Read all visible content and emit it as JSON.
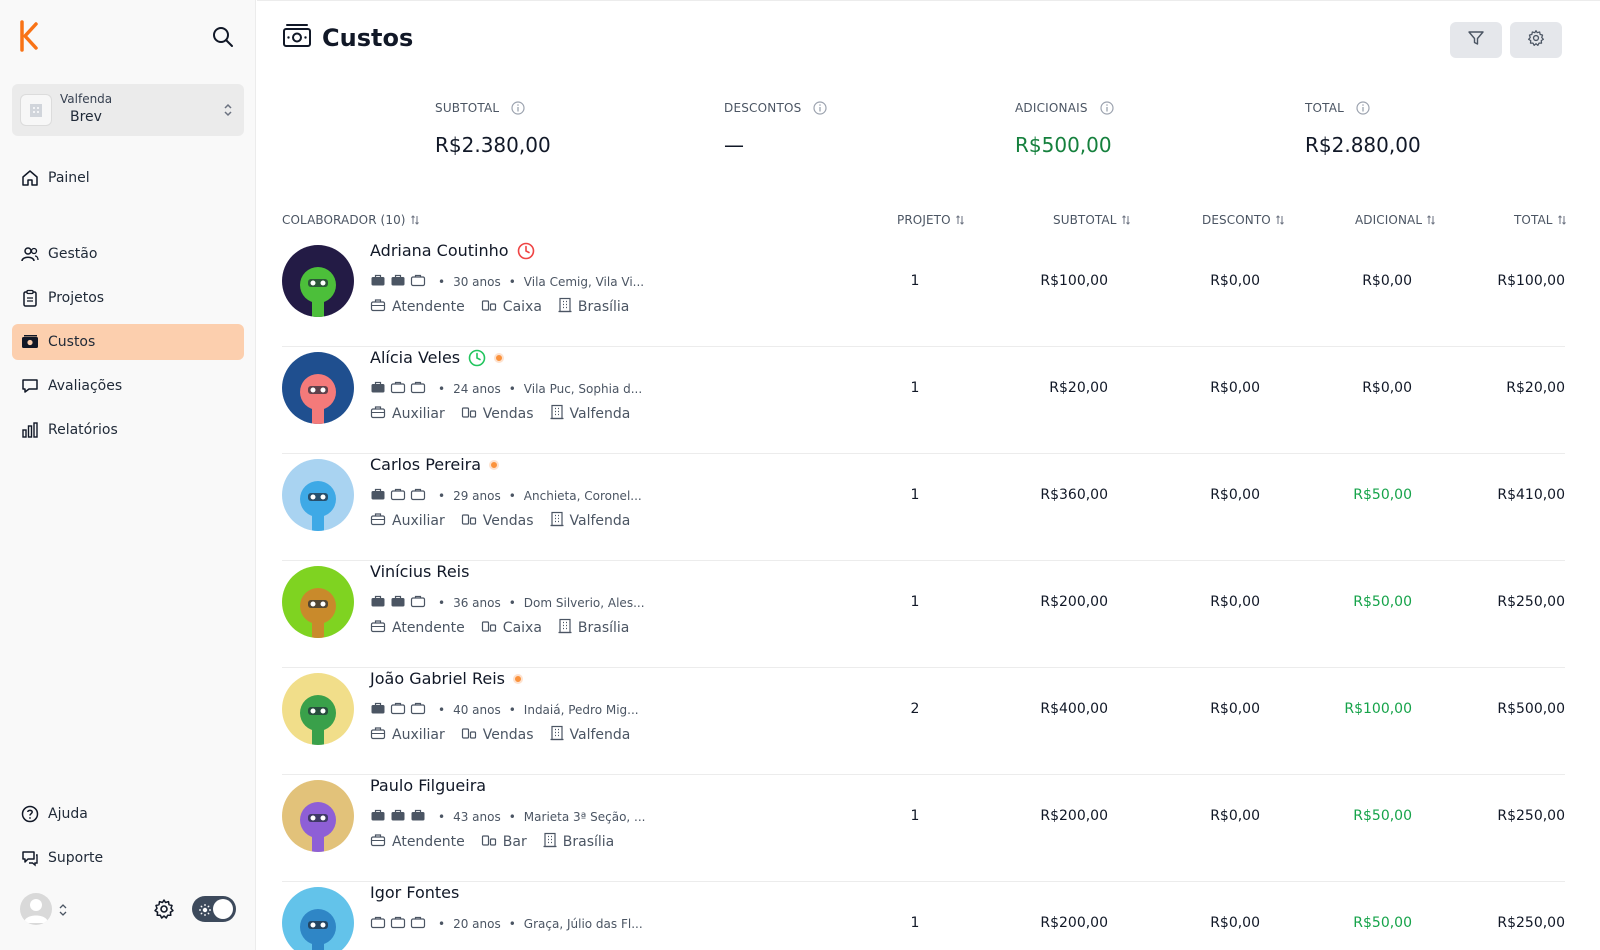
{
  "sidebar": {
    "org": {
      "sub": "Valfenda",
      "name": "Brev"
    },
    "nav": [
      {
        "label": "Painel",
        "icon": "home-icon"
      },
      {
        "label": "Gestão",
        "icon": "users-icon"
      },
      {
        "label": "Projetos",
        "icon": "clipboard-icon"
      },
      {
        "label": "Custos",
        "icon": "money-icon",
        "active": true
      },
      {
        "label": "Avaliações",
        "icon": "chat-icon"
      },
      {
        "label": "Relatórios",
        "icon": "bar-chart-icon"
      }
    ],
    "bottom": [
      {
        "label": "Ajuda",
        "icon": "help-icon"
      },
      {
        "label": "Suporte",
        "icon": "support-icon"
      }
    ]
  },
  "header": {
    "title": "Custos"
  },
  "summary": {
    "subtotal_label": "SUBTOTAL",
    "subtotal_value": "R$2.380,00",
    "discount_label": "DESCONTOS",
    "discount_value": "—",
    "extra_label": "ADICIONAIS",
    "extra_value": "R$500,00",
    "total_label": "TOTAL",
    "total_value": "R$2.880,00"
  },
  "table": {
    "headers": {
      "collaborator": "COLABORADOR (10)",
      "project": "PROJETO",
      "subtotal": "SUBTOTAL",
      "discount": "DESCONTO",
      "extra": "ADICIONAL",
      "total": "TOTAL"
    },
    "rows": [
      {
        "name": "Adriana Coutinho",
        "status": "clock-red",
        "level": 2,
        "age": "30 anos",
        "address": "Vila Cemig, Vila Vi...",
        "role": "Atendente",
        "sector": "Caixa",
        "unit": "Brasília",
        "project": "1",
        "subtotal": "R$100,00",
        "discount": "R$0,00",
        "extra": "R$0,00",
        "extra_green": false,
        "total": "R$100,00",
        "bg": "#231b45",
        "fg": "#4cbf3a"
      },
      {
        "name": "Alícia Veles",
        "status": "clock-green-dot",
        "level": 1,
        "age": "24 anos",
        "address": "Vila Puc, Sophia d...",
        "role": "Auxiliar",
        "sector": "Vendas",
        "unit": "Valfenda",
        "project": "1",
        "subtotal": "R$20,00",
        "discount": "R$0,00",
        "extra": "R$0,00",
        "extra_green": false,
        "total": "R$20,00",
        "bg": "#1f4f8f",
        "fg": "#f47a7a"
      },
      {
        "name": "Carlos Pereira",
        "status": "dot",
        "level": 1,
        "age": "29 anos",
        "address": "Anchieta, Coronel...",
        "role": "Auxiliar",
        "sector": "Vendas",
        "unit": "Valfenda",
        "project": "1",
        "subtotal": "R$360,00",
        "discount": "R$0,00",
        "extra": "R$50,00",
        "extra_green": true,
        "total": "R$410,00",
        "bg": "#a9d3f1",
        "fg": "#3ea9e6"
      },
      {
        "name": "Vinícius Reis",
        "status": "",
        "level": 2,
        "age": "36 anos",
        "address": "Dom Silverio, Ales...",
        "role": "Atendente",
        "sector": "Caixa",
        "unit": "Brasília",
        "project": "1",
        "subtotal": "R$200,00",
        "discount": "R$0,00",
        "extra": "R$50,00",
        "extra_green": true,
        "total": "R$250,00",
        "bg": "#7fd321",
        "fg": "#c98a2b"
      },
      {
        "name": "João Gabriel Reis",
        "status": "dot",
        "level": 1,
        "age": "40 anos",
        "address": "Indaiá, Pedro Mig...",
        "role": "Auxiliar",
        "sector": "Vendas",
        "unit": "Valfenda",
        "project": "2",
        "subtotal": "R$400,00",
        "discount": "R$0,00",
        "extra": "R$100,00",
        "extra_green": true,
        "total": "R$500,00",
        "bg": "#f1de8a",
        "fg": "#39a04a"
      },
      {
        "name": "Paulo Filgueira",
        "status": "",
        "level": 3,
        "age": "43 anos",
        "address": "Marieta 3ª Seção, ...",
        "role": "Atendente",
        "sector": "Bar",
        "unit": "Brasília",
        "project": "1",
        "subtotal": "R$200,00",
        "discount": "R$0,00",
        "extra": "R$50,00",
        "extra_green": true,
        "total": "R$250,00",
        "bg": "#e2c27a",
        "fg": "#8e5fd6"
      },
      {
        "name": "Igor Fontes",
        "status": "",
        "level": 0,
        "age": "20 anos",
        "address": "Graça, Júlio das Fl...",
        "role": "",
        "sector": "",
        "unit": "",
        "project": "1",
        "subtotal": "R$200,00",
        "discount": "R$0,00",
        "extra": "R$50,00",
        "extra_green": true,
        "total": "R$250,00",
        "bg": "#63c3ea",
        "fg": "#2f86c6"
      }
    ]
  },
  "colors": {
    "accent": "#f97316",
    "active_nav": "#fccfae",
    "positive": "#16a34a"
  }
}
